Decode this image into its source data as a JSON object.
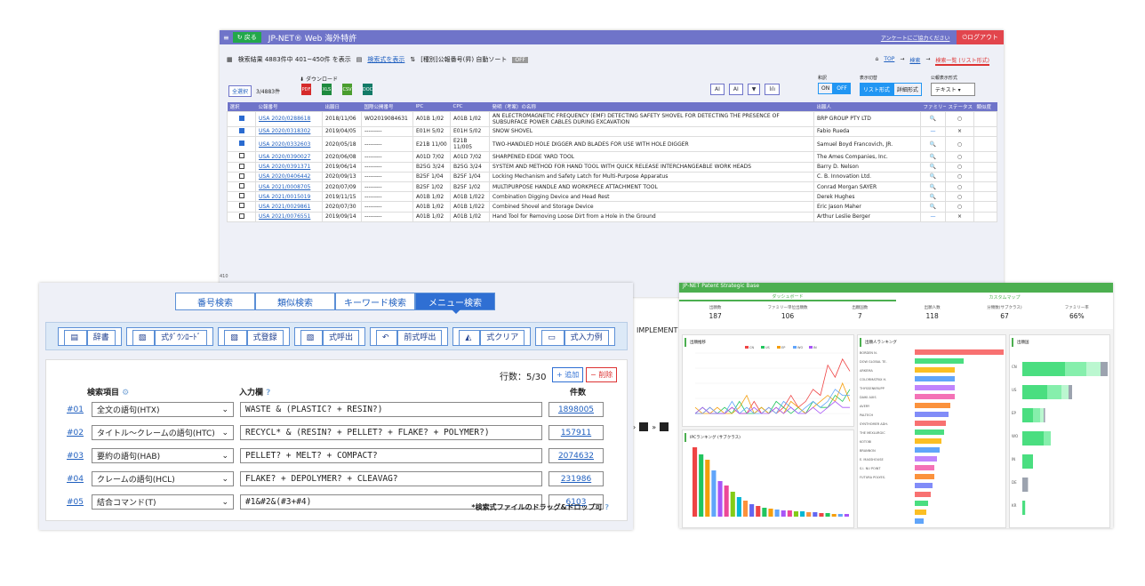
{
  "main": {
    "app": {
      "menu_icon": "≡",
      "back": "戻る",
      "title": "JP-NET® Web 海外特許",
      "survey": "アンケートにご協力ください",
      "logout": "ログアウト"
    },
    "summary": {
      "prefix": "検索結果 4883件中 401~450件 を表示",
      "show_formula": "検索式を表示",
      "sort_label": "[種別]公報番号(昇) 自動ソート",
      "sort_state": "OFF"
    },
    "breadcrumb": {
      "top": "TOP",
      "search": "検索",
      "list": "検索一覧 (リスト形式)"
    },
    "download": {
      "label": "ダウンロード",
      "files": [
        "PDF",
        "XLS",
        "CSV",
        "DOC"
      ]
    },
    "select": {
      "all": "全選択",
      "count": "3/4883件"
    },
    "tools": [
      "AI",
      "AI",
      "▼",
      "lılı"
    ],
    "options": {
      "trans_label": "和訳",
      "trans_on": "ON",
      "trans_off": "OFF",
      "view_label": "表示切替",
      "view_list": "リスト形式",
      "view_detail": "詳細形式",
      "pubfmt_label": "公報表示形式",
      "pubfmt_value": "テキスト"
    },
    "columns": [
      "選択",
      "公報番号",
      "出願日",
      "国際公開番号",
      "IPC",
      "CPC",
      "発明（考案）の名称",
      "出願人",
      "ファミリー",
      "ステータス",
      "類似度"
    ],
    "rows": [
      {
        "checked": true,
        "no": "USA 2020/0288618",
        "date": "2018/11/06",
        "intl": "WO2019084631",
        "ipc": "A01B 1/02",
        "cpc": "A01B 1/02",
        "title": "AN ELECTROMAGNETIC FREQUENCY (EMF) DETECTING SAFETY SHOVEL FOR DETECTING THE PRESENCE OF SUBSURFACE POWER CABLES DURING EXCAVATION",
        "applicant": "BRP GROUP PTY LTD",
        "fam": "🔍",
        "status": "○"
      },
      {
        "checked": true,
        "no": "USA 2020/0318302",
        "date": "2019/04/05",
        "intl": "---------",
        "ipc": "E01H 5/02",
        "cpc": "E01H 5/02",
        "title": "SNOW SHOVEL",
        "applicant": "Fabio Rueda",
        "fam": "—",
        "status": "×"
      },
      {
        "checked": true,
        "no": "USA 2020/0332603",
        "date": "2020/05/18",
        "intl": "---------",
        "ipc": "E21B 11/00",
        "cpc": "E21B 11/005",
        "title": "TWO-HANDLED HOLE DIGGER AND BLADES FOR USE WITH HOLE DIGGER",
        "applicant": "Samuel Boyd Francovich, JR.",
        "fam": "🔍",
        "status": "○"
      },
      {
        "checked": false,
        "no": "USA 2020/0390027",
        "date": "2020/06/08",
        "intl": "---------",
        "ipc": "A01D 7/02",
        "cpc": "A01D 7/02",
        "title": "SHARPENED EDGE YARD TOOL",
        "applicant": "The Ames Companies, Inc.",
        "fam": "🔍",
        "status": "○"
      },
      {
        "checked": false,
        "no": "USA 2020/0391371",
        "date": "2019/06/14",
        "intl": "---------",
        "ipc": "B25G 3/24",
        "cpc": "B25G 3/24",
        "title": "SYSTEM AND METHOD FOR HAND TOOL WITH QUICK RELEASE INTERCHANGEABLE WORK HEADS",
        "applicant": "Barry D. Nelson",
        "fam": "🔍",
        "status": "○"
      },
      {
        "checked": false,
        "no": "USA 2020/0406442",
        "date": "2020/09/13",
        "intl": "---------",
        "ipc": "B25F 1/04",
        "cpc": "B25F 1/04",
        "title": "Locking Mechanism and Safety Latch for Multi-Purpose Apparatus",
        "applicant": "C. B. Innovation Ltd.",
        "fam": "🔍",
        "status": "○"
      },
      {
        "checked": false,
        "no": "USA 2021/0008705",
        "date": "2020/07/09",
        "intl": "---------",
        "ipc": "B25F 1/02",
        "cpc": "B25F 1/02",
        "title": "MULTIPURPOSE HANDLE AND WORKPIECE ATTACHMENT TOOL",
        "applicant": "Conrad Morgan SAYER",
        "fam": "🔍",
        "status": "○"
      },
      {
        "checked": false,
        "no": "USA 2021/0015019",
        "date": "2019/11/15",
        "intl": "---------",
        "ipc": "A01B 1/02",
        "cpc": "A01B 1/022",
        "title": "Combination Digging Device and Head Rest",
        "applicant": "Derek Hughes",
        "fam": "🔍",
        "status": "○"
      },
      {
        "checked": false,
        "no": "USA 2021/0029861",
        "date": "2020/07/30",
        "intl": "---------",
        "ipc": "A01B 1/02",
        "cpc": "A01B 1/022",
        "title": "Combined Shovel and Storage Device",
        "applicant": "Eric Jason Maher",
        "fam": "🔍",
        "status": "○"
      },
      {
        "checked": false,
        "no": "USA 2021/0076551",
        "date": "2019/09/14",
        "intl": "---------",
        "ipc": "A01B 1/02",
        "cpc": "A01B 1/02",
        "title": "Hand Tool for Removing Loose Dirt from a Hole in the Ground",
        "applicant": "Arthur Leslie Berger",
        "fam": "—",
        "status": "×"
      }
    ],
    "row_index": "410",
    "behind_text": "IMPLEMENT"
  },
  "search": {
    "tabs": [
      "番号検索",
      "類似検索",
      "キーワード検索",
      "メニュー検索"
    ],
    "buttons": [
      "辞書",
      "式ﾀﾞｳﾝﾛｰﾄﾞ",
      "式登録",
      "式呼出",
      "前式呼出",
      "式クリア",
      "式入力例"
    ],
    "rowcount": "行数：5/30",
    "add": "+ 追加",
    "del": "− 削除",
    "head_item": "検索項目",
    "head_input": "入力欄",
    "head_count": "件数",
    "rows": [
      {
        "no": "#01",
        "field": "全文の語句(HTX)",
        "query": "WASTE & (PLASTIC? + RESIN?)",
        "count": "1898005"
      },
      {
        "no": "#02",
        "field": "タイトル～クレームの語句(HTC)",
        "query": "RECYCL* & (RESIN? + PELLET? + FLAKE? + POLYMER?)",
        "count": "157911"
      },
      {
        "no": "#03",
        "field": "要約の語句(HAB)",
        "query": "PELLET? + MELT? + COMPACT?",
        "count": "2074632"
      },
      {
        "no": "#04",
        "field": "クレームの語句(HCL)",
        "query": "FLAKE? + DEPOLYMER? + CLEAVAG?",
        "count": "231986"
      },
      {
        "no": "#05",
        "field": "結合コマンド(T)",
        "query": "#1&#2&(#3+#4)",
        "count": "6103"
      }
    ],
    "note": "*検索式ファイルのドラッグ&ドロップ可"
  },
  "dash": {
    "title": "JP-NET Patent Strategic Base",
    "tabs": [
      "ダッシュボード",
      "カスタムマップ"
    ],
    "stats": [
      {
        "label": "出願数",
        "value": "187"
      },
      {
        "label": "ファミリー単位出願数",
        "value": "106"
      },
      {
        "label": "出願国数",
        "value": "7"
      },
      {
        "label": "出願人数",
        "value": "118"
      },
      {
        "label": "分類数(サブクラス)",
        "value": "67"
      },
      {
        "label": "ファミリー率",
        "value": "66%"
      }
    ],
    "cards": [
      "出願推移",
      "出願人ランキング",
      "出願国",
      "IPCランキング (サブクラス)"
    ],
    "legend": [
      "CN",
      "US",
      "EP",
      "WO",
      "IN"
    ],
    "colors": [
      "#ef4444",
      "#22c55e",
      "#f59e0b",
      "#60a5fa",
      "#a855f7"
    ],
    "line_series": [
      [
        0,
        0,
        1,
        0,
        0,
        1,
        0,
        0,
        2,
        0,
        1,
        0,
        1,
        3,
        1,
        2,
        4,
        3,
        8,
        6,
        9,
        7
      ],
      [
        0,
        1,
        0,
        0,
        1,
        0,
        2,
        0,
        0,
        1,
        0,
        2,
        1,
        0,
        1,
        0,
        2,
        1,
        1,
        3,
        2,
        4
      ],
      [
        1,
        0,
        0,
        1,
        0,
        0,
        1,
        3,
        0,
        1,
        0,
        1,
        0,
        2,
        1,
        0,
        1,
        2,
        3,
        2,
        5,
        2
      ],
      [
        0,
        0,
        1,
        0,
        0,
        2,
        0,
        1,
        0,
        0,
        1,
        0,
        2,
        1,
        0,
        1,
        2,
        1,
        2,
        4,
        3,
        3
      ],
      [
        0,
        1,
        0,
        0,
        0,
        1,
        0,
        0,
        1,
        0,
        0,
        1,
        0,
        1,
        0,
        0,
        1,
        0,
        1,
        2,
        1,
        1
      ]
    ],
    "ipc_bars": [
      78,
      70,
      64,
      52,
      40,
      35,
      28,
      22,
      18,
      14,
      12,
      10,
      9,
      8,
      7,
      7,
      6,
      6,
      5,
      5,
      4,
      4,
      3,
      3,
      3
    ],
    "applicant_bars": [
      100,
      55,
      45,
      45,
      45,
      45,
      40,
      38,
      35,
      33,
      30,
      28,
      25,
      22,
      22,
      20,
      18,
      15,
      13,
      10
    ],
    "applicant_names": [
      "BORDEN N.",
      "DOW GLOBAL TE.",
      "ARKEMA",
      "COLORMATRIX H.",
      "THYSSENKRUPP",
      "DAIKI AXIS",
      "AVERY",
      "PALTECH",
      "SYNTHOMER ADH.",
      "THE MEXLURGIC",
      "KOTOBI",
      "BRANNON",
      "E. MASSHOUSE",
      "S.I. NU POINT",
      "FUTURA POLYES.",
      "",
      "",
      "",
      "",
      ""
    ],
    "country_bars": [
      {
        "name": "CN",
        "v": [
          60,
          30,
          20,
          10
        ]
      },
      {
        "name": "US",
        "v": [
          35,
          20,
          10,
          5
        ]
      },
      {
        "name": "EP",
        "v": [
          15,
          10,
          5,
          2
        ]
      },
      {
        "name": "WO",
        "v": [
          30,
          10,
          0,
          0
        ]
      },
      {
        "name": "IN",
        "v": [
          15,
          0,
          0,
          0
        ]
      },
      {
        "name": "DE",
        "v": [
          8,
          0,
          0,
          0
        ]
      },
      {
        "name": "KR",
        "v": [
          4,
          0,
          0,
          0
        ]
      }
    ]
  }
}
